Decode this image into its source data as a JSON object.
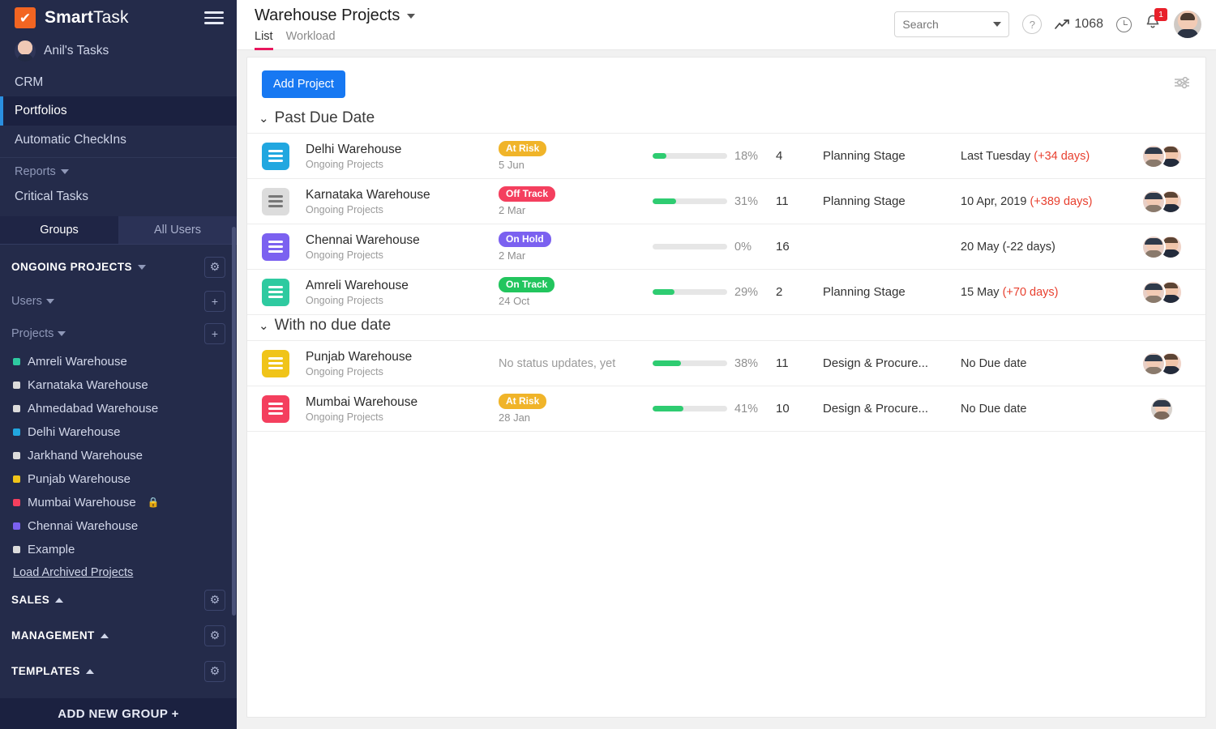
{
  "sidebar": {
    "logo": {
      "brand_bold": "Smart",
      "brand_light": "Task",
      "icon": "check-logo-icon"
    },
    "user": {
      "name": "Anil's Tasks"
    },
    "nav": [
      {
        "label": "CRM",
        "active": false
      },
      {
        "label": "Portfolios",
        "active": true
      },
      {
        "label": "Automatic CheckIns",
        "active": false
      }
    ],
    "reports_label": "Reports",
    "critical_tasks_label": "Critical Tasks",
    "tabs": [
      {
        "label": "Groups",
        "active": true
      },
      {
        "label": "All Users",
        "active": false
      }
    ],
    "group_title": "ONGOING PROJECTS",
    "users_label": "Users",
    "projects_label": "Projects",
    "projects": [
      {
        "label": "Amreli Warehouse",
        "color": "#2ecaa0",
        "locked": false
      },
      {
        "label": "Karnataka Warehouse",
        "color": "#dcdcdc",
        "locked": false
      },
      {
        "label": "Ahmedabad Warehouse",
        "color": "#dcdcdc",
        "locked": false
      },
      {
        "label": "Delhi Warehouse",
        "color": "#21a7e0",
        "locked": false
      },
      {
        "label": "Jarkhand Warehouse",
        "color": "#dcdcdc",
        "locked": false
      },
      {
        "label": "Punjab Warehouse",
        "color": "#f0c419",
        "locked": false
      },
      {
        "label": "Mumbai Warehouse",
        "color": "#f43f5e",
        "locked": true
      },
      {
        "label": "Chennai Warehouse",
        "color": "#7b61f0",
        "locked": false
      },
      {
        "label": "Example",
        "color": "#dcdcdc",
        "locked": false
      }
    ],
    "load_archived_label": "Load Archived Projects",
    "groups": [
      {
        "label": "SALES"
      },
      {
        "label": "MANAGEMENT"
      },
      {
        "label": "TEMPLATES"
      }
    ],
    "add_new_group_label": "ADD NEW GROUP +"
  },
  "header": {
    "title": "Warehouse Projects",
    "tabs": [
      {
        "label": "List",
        "active": true
      },
      {
        "label": "Workload",
        "active": false
      }
    ],
    "search": {
      "placeholder": "Search",
      "value": ""
    },
    "help_icon": "question-mark-icon",
    "points_icon": "trending-up-icon",
    "points_value": "1068",
    "clock_icon": "clock-icon",
    "bell_icon": "bell-icon",
    "bell_badge": "1",
    "avatar_icon": "user-avatar"
  },
  "toolbar": {
    "add_project_label": "Add Project",
    "filter_icon": "sliders-filter-icon"
  },
  "sections": [
    {
      "title": "Past Due Date",
      "rows": [
        {
          "name": "Delhi Warehouse",
          "subtitle": "Ongoing Projects",
          "tile_color": "#21a7e0",
          "status": "At Risk",
          "status_color": "#f0b429",
          "status_date": "5 Jun",
          "progress": 18,
          "progress_label": "18%",
          "count": "4",
          "stage": "Planning Stage",
          "due": "Last Tuesday",
          "due_delta": "(+34 days)",
          "due_overdue": true,
          "avatars": 2
        },
        {
          "name": "Karnataka Warehouse",
          "subtitle": "Ongoing Projects",
          "tile_color": "#dcdcdc",
          "status": "Off Track",
          "status_color": "#f43f5e",
          "status_date": "2 Mar",
          "progress": 31,
          "progress_label": "31%",
          "count": "11",
          "stage": "Planning Stage",
          "due": "10 Apr, 2019",
          "due_delta": "(+389 days)",
          "due_overdue": true,
          "avatars": 2
        },
        {
          "name": "Chennai Warehouse",
          "subtitle": "Ongoing Projects",
          "tile_color": "#7b61f0",
          "status": "On Hold",
          "status_color": "#7b61f0",
          "status_date": "2 Mar",
          "progress": 0,
          "progress_label": "0%",
          "count": "16",
          "stage": "",
          "due": "20 May (-22 days)",
          "due_delta": "",
          "due_overdue": false,
          "avatars": 2
        },
        {
          "name": "Amreli Warehouse",
          "subtitle": "Ongoing Projects",
          "tile_color": "#2ecaa0",
          "status": "On Track",
          "status_color": "#22c55e",
          "status_date": "24 Oct",
          "progress": 29,
          "progress_label": "29%",
          "count": "2",
          "stage": "Planning Stage",
          "due": "15 May",
          "due_delta": "(+70 days)",
          "due_overdue": true,
          "avatars": 2
        }
      ]
    },
    {
      "title": "With no due date",
      "rows": [
        {
          "name": "Punjab Warehouse",
          "subtitle": "Ongoing Projects",
          "tile_color": "#f0c419",
          "status": "",
          "status_color": "",
          "status_empty_text": "No status updates, yet",
          "status_date": "",
          "progress": 38,
          "progress_label": "38%",
          "count": "11",
          "stage": "Design & Procure...",
          "due": "No Due date",
          "due_delta": "",
          "due_overdue": false,
          "avatars": 2
        },
        {
          "name": "Mumbai Warehouse",
          "subtitle": "Ongoing Projects",
          "tile_color": "#f43f5e",
          "status": "At Risk",
          "status_color": "#f0b429",
          "status_date": "28 Jan",
          "progress": 41,
          "progress_label": "41%",
          "count": "10",
          "stage": "Design & Procure...",
          "due": "No Due date",
          "due_delta": "",
          "due_overdue": false,
          "avatars": 1
        }
      ]
    }
  ]
}
